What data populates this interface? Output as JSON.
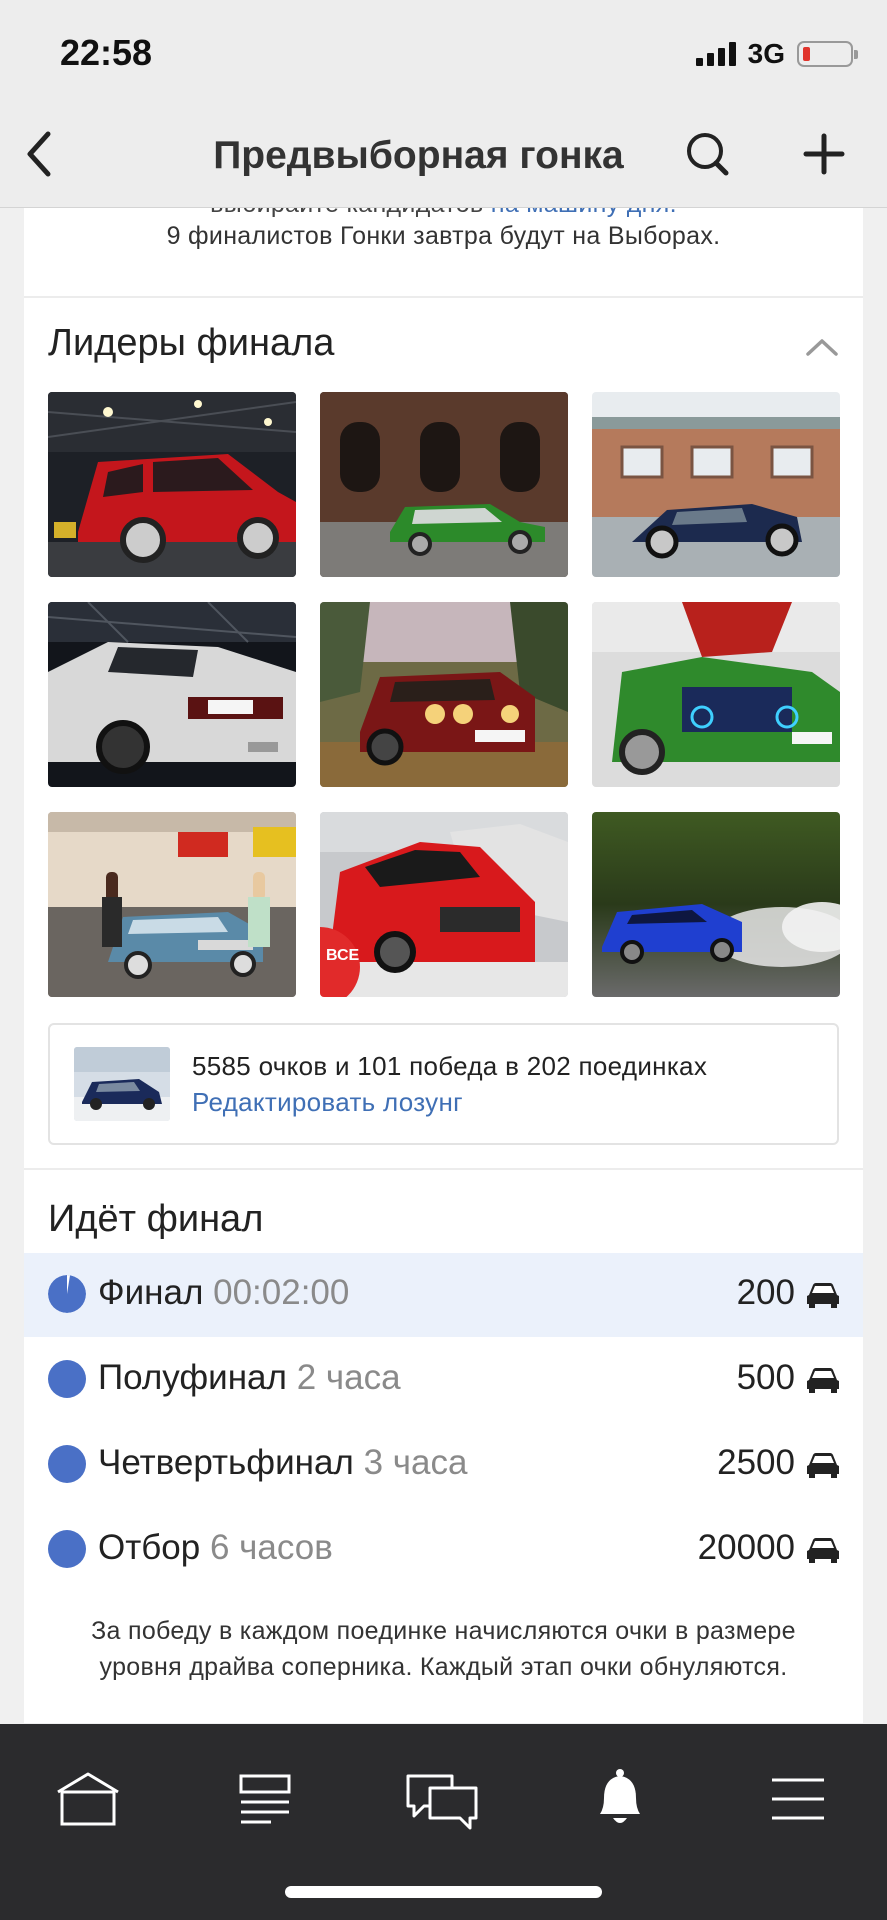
{
  "status_bar": {
    "time": "22:58",
    "network": "3G"
  },
  "nav": {
    "title": "Предвыборная гонка"
  },
  "intro": {
    "cut_line_text": "выбирайте кандидатов ",
    "cut_line_link": "на машину дня.",
    "line": "9 финалистов Гонки завтра будут на Выборах."
  },
  "leaders": {
    "title": "Лидеры финала",
    "photos": [
      {
        "icon": "car-photo-red-wagon"
      },
      {
        "icon": "car-photo-green-sedan"
      },
      {
        "icon": "car-photo-blue-hatchback"
      },
      {
        "icon": "car-photo-white-coupe"
      },
      {
        "icon": "car-photo-red-golf"
      },
      {
        "icon": "car-photo-green-tuned-sedan"
      },
      {
        "icon": "car-photo-blue-volga"
      },
      {
        "icon": "car-photo-red-lancer"
      },
      {
        "icon": "car-photo-blue-drift-car"
      }
    ]
  },
  "slogan": {
    "stats": "5585 очков и 101 победа в 202 поединках",
    "edit_link": "Редактировать лозунг"
  },
  "stages": {
    "title": "Идёт финал",
    "items": [
      {
        "name": "Финал",
        "time": "00:02:00",
        "count": "200",
        "active": true
      },
      {
        "name": "Полуфинал",
        "time": "2 часа",
        "count": "500",
        "active": false
      },
      {
        "name": "Четвертьфинал",
        "time": "3 часа",
        "count": "2500",
        "active": false
      },
      {
        "name": "Отбор",
        "time": "6 часов",
        "count": "20000",
        "active": false
      }
    ]
  },
  "footnote": {
    "line1": "За победу в каждом поединке начисляются очки в размере",
    "line2": "уровня драйва соперника. Каждый этап очки обнуляются."
  },
  "colors": {
    "accent": "#4a70c6",
    "link": "#3f6fb5",
    "active_row": "#ebf1fb",
    "tab_bar": "#2b2b2d"
  }
}
